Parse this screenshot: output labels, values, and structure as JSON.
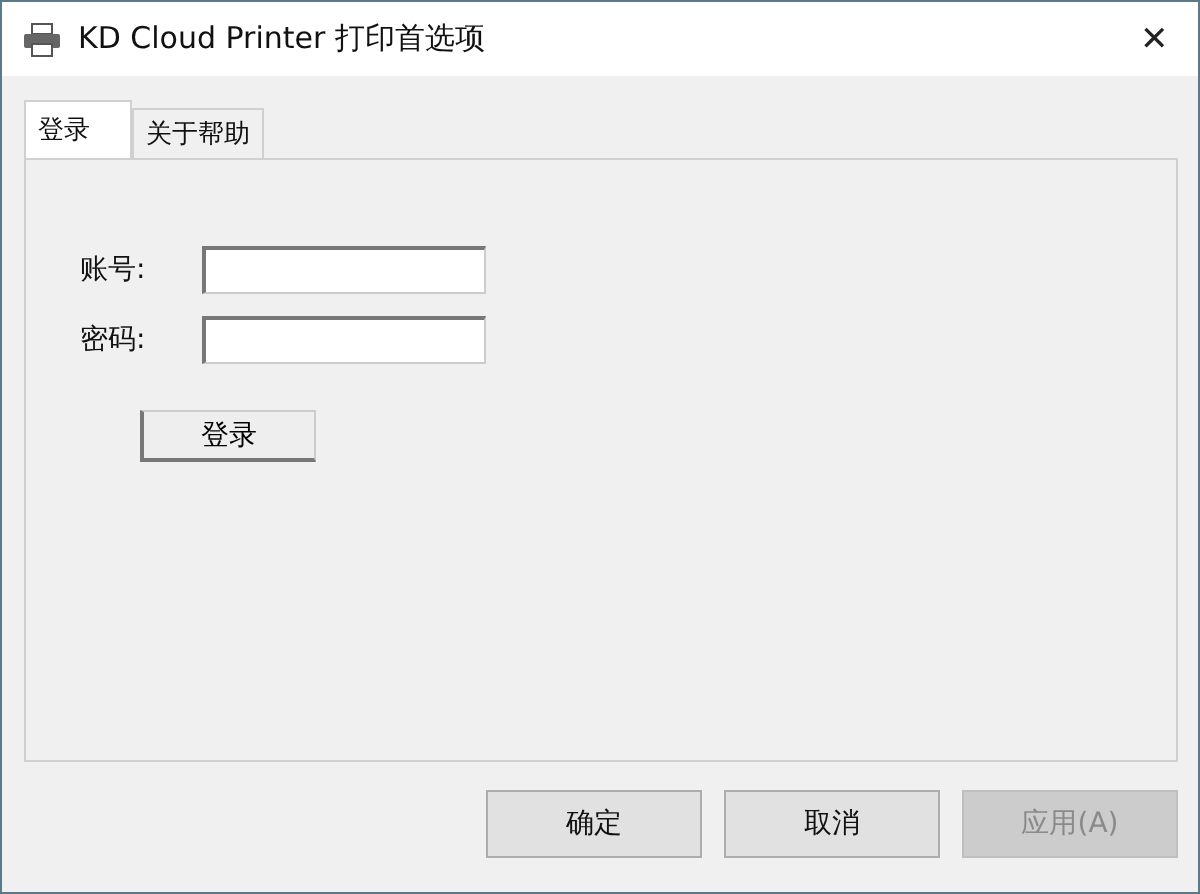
{
  "window": {
    "title": "KD Cloud Printer 打印首选项",
    "close": "✕"
  },
  "tabs": [
    {
      "label": "登录",
      "selected": true
    },
    {
      "label": "关于帮助",
      "selected": false
    }
  ],
  "form": {
    "fields": [
      {
        "label": "账号:"
      },
      {
        "label": "密码:"
      }
    ],
    "login_button": "登录"
  },
  "buttons": [
    {
      "label": "确定",
      "disabled": false
    },
    {
      "label": "取消",
      "disabled": false
    },
    {
      "label": "应用(A)",
      "disabled": true
    }
  ]
}
